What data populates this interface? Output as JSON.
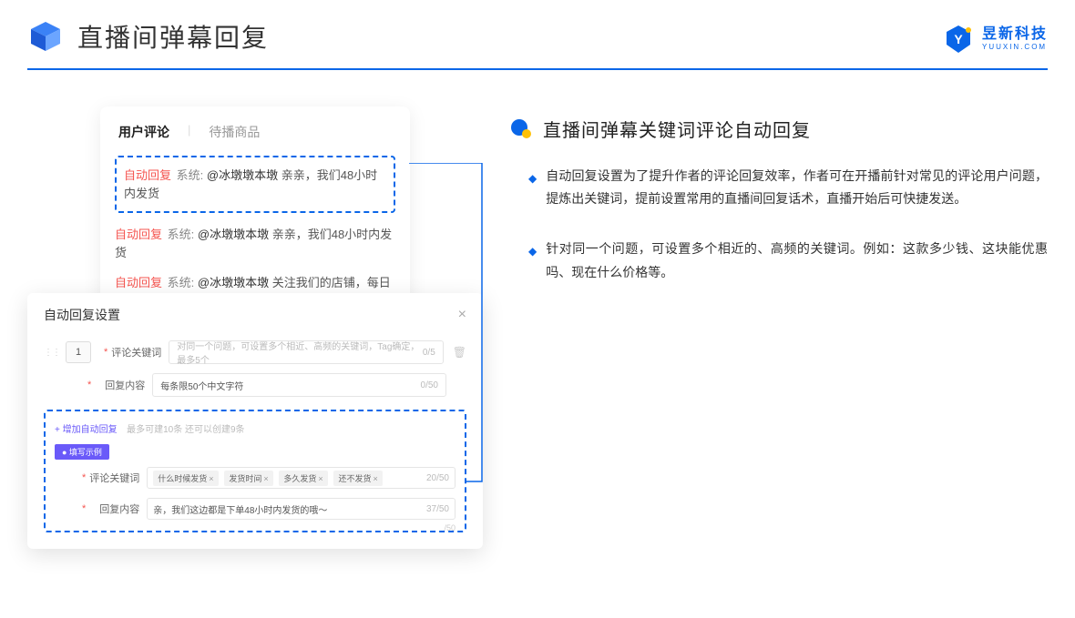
{
  "header": {
    "title": "直播间弹幕回复",
    "brand": "昱新科技",
    "brand_sub": "YUUXIN.COM"
  },
  "comment_card": {
    "tab_active": "用户评论",
    "tab_other": "待播商品",
    "tag": "自动回复",
    "sys_label": "系统:",
    "msg1_user": "@冰墩墩本墩",
    "msg1_body": "亲亲，我们48小时内发货",
    "msg2_user": "@冰墩墩本墩",
    "msg2_body": "亲亲，我们48小时内发货",
    "msg3_user": "@冰墩墩本墩",
    "msg3_body": "关注我们的店铺，每日都有热门推荐呦～"
  },
  "settings": {
    "title": "自动回复设置",
    "idx": "1",
    "label_keyword": "评论关键词",
    "label_reply": "回复内容",
    "placeholder_keyword": "对同一个问题，可设置多个相近、高频的关键词，Tag确定，最多5个",
    "placeholder_keyword_count": "0/5",
    "placeholder_reply": "每条限50个中文字符",
    "placeholder_reply_count": "0/50",
    "add_link": "+ 增加自动回复",
    "hint": "最多可建10条 还可以创建9条",
    "example_badge": "● 填写示例",
    "example_tag1": "什么时候发货",
    "example_tag2": "发货时间",
    "example_tag3": "多久发货",
    "example_tag4": "还不发货",
    "example_keyword_count": "20/50",
    "example_reply": "亲，我们这边都是下单48小时内发货的哦～",
    "example_reply_count": "37/50",
    "trailing_count": "/50"
  },
  "section": {
    "title": "直播间弹幕关键词评论自动回复",
    "bullet1": "自动回复设置为了提升作者的评论回复效率，作者可在开播前针对常见的评论用户问题，提炼出关键词，提前设置常用的直播间回复话术，直播开始后可快捷发送。",
    "bullet2": "针对同一个问题，可设置多个相近的、高频的关键词。例如：这款多少钱、这块能优惠吗、现在什么价格等。"
  }
}
